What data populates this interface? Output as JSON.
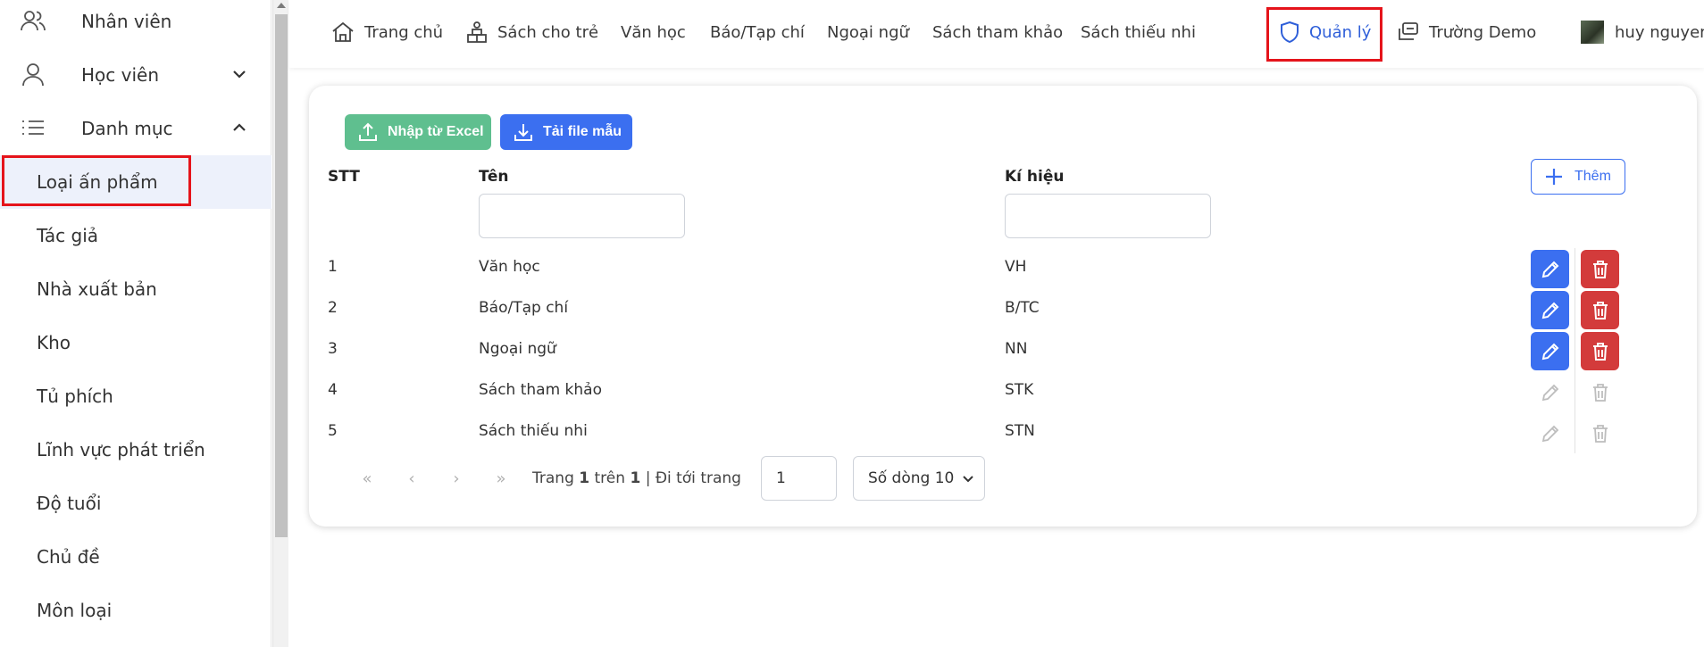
{
  "sidebar": {
    "items": [
      {
        "label": "Nhân viên",
        "icon": "users-icon"
      },
      {
        "label": "Học viên",
        "icon": "user-icon",
        "expanded": false
      },
      {
        "label": "Danh mục",
        "icon": "list-icon",
        "expanded": true
      }
    ],
    "sub_items": [
      {
        "label": "Loại ấn phẩm",
        "active": true
      },
      {
        "label": "Tác giả"
      },
      {
        "label": "Nhà xuất bản"
      },
      {
        "label": "Kho"
      },
      {
        "label": "Tủ phích"
      },
      {
        "label": "Lĩnh vực phát triển"
      },
      {
        "label": "Độ tuổi"
      },
      {
        "label": "Chủ đề"
      },
      {
        "label": "Môn loại"
      }
    ]
  },
  "topnav": {
    "items": [
      {
        "label": "Trang chủ",
        "icon": "home-icon"
      },
      {
        "label": "Sách cho trẻ",
        "icon": "toy-icon"
      },
      {
        "label": "Văn học"
      },
      {
        "label": "Báo/Tạp chí"
      },
      {
        "label": "Ngoại ngữ"
      },
      {
        "label": "Sách tham khảo"
      },
      {
        "label": "Sách thiếu nhi"
      }
    ],
    "manage": {
      "label": "Quản lý",
      "icon": "shield-icon"
    },
    "school": {
      "label": "Trường Demo",
      "icon": "switch-icon"
    },
    "user": {
      "label": "huy nguyen"
    }
  },
  "toolbar": {
    "import_label": "Nhập từ Excel",
    "template_label": "Tải file mẫu",
    "add_label": "Thêm"
  },
  "table": {
    "headers": {
      "stt": "STT",
      "name": "Tên",
      "code": "Kí hiệu"
    },
    "rows": [
      {
        "stt": "1",
        "name": "Văn học",
        "code": "VH",
        "editable": true
      },
      {
        "stt": "2",
        "name": "Báo/Tạp chí",
        "code": "B/TC",
        "editable": true
      },
      {
        "stt": "3",
        "name": "Ngoại ngữ",
        "code": "NN",
        "editable": true
      },
      {
        "stt": "4",
        "name": "Sách tham khảo",
        "code": "STK",
        "editable": false
      },
      {
        "stt": "5",
        "name": "Sách thiếu nhi",
        "code": "STN",
        "editable": false
      }
    ]
  },
  "pagination": {
    "page_word": "Trang",
    "current": "1",
    "of_word": "trên",
    "total": "1",
    "goto_label": "| Đi tới trang",
    "goto_value": "1",
    "rows_label": "Số dòng 10"
  },
  "colors": {
    "accent": "#3b6ff0",
    "danger": "#d33b3b",
    "success": "#5fbf8f",
    "highlight": "#e5141b"
  }
}
